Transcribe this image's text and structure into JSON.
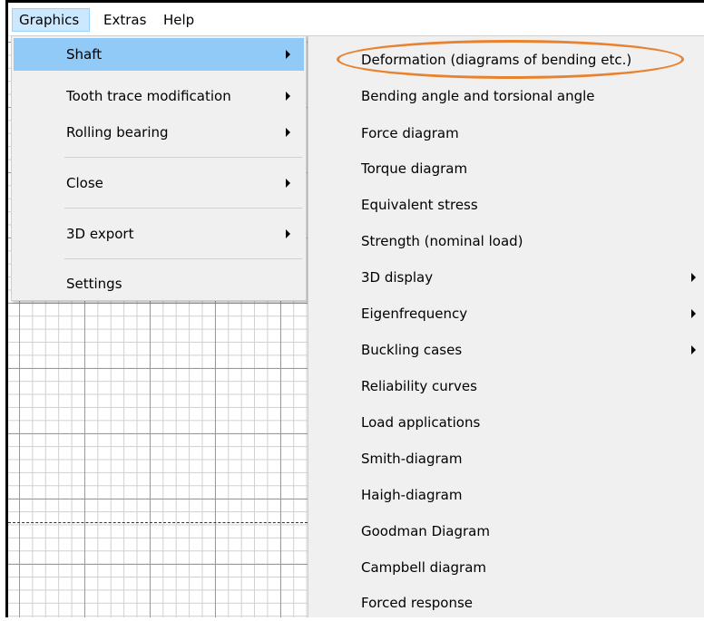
{
  "menubar": {
    "items": [
      "Graphics",
      "Extras",
      "Help"
    ]
  },
  "graphics_menu": {
    "items": [
      {
        "label": "Shaft",
        "has_submenu": true
      },
      {
        "label": "Tooth trace modification",
        "has_submenu": true
      },
      {
        "label": "Rolling bearing",
        "has_submenu": true
      },
      {
        "label": "Close",
        "has_submenu": true
      },
      {
        "label": "3D export",
        "has_submenu": true
      },
      {
        "label": "Settings",
        "has_submenu": false
      }
    ]
  },
  "shaft_submenu": {
    "items": [
      {
        "label": "Deformation (diagrams of bending etc.)",
        "has_submenu": false
      },
      {
        "label": "Bending angle and torsional angle",
        "has_submenu": false
      },
      {
        "label": "Force diagram",
        "has_submenu": false
      },
      {
        "label": "Torque diagram",
        "has_submenu": false
      },
      {
        "label": "Equivalent stress",
        "has_submenu": false
      },
      {
        "label": "Strength (nominal load)",
        "has_submenu": false
      },
      {
        "label": "3D display",
        "has_submenu": true
      },
      {
        "label": "Eigenfrequency",
        "has_submenu": true
      },
      {
        "label": "Buckling cases",
        "has_submenu": true
      },
      {
        "label": "Reliability curves",
        "has_submenu": false
      },
      {
        "label": "Load applications",
        "has_submenu": false
      },
      {
        "label": "Smith-diagram",
        "has_submenu": false
      },
      {
        "label": "Haigh-diagram",
        "has_submenu": false
      },
      {
        "label": "Goodman Diagram",
        "has_submenu": false
      },
      {
        "label": "Campbell diagram",
        "has_submenu": false
      },
      {
        "label": "Forced response",
        "has_submenu": false
      }
    ]
  },
  "colors": {
    "highlight": "#91c9f7",
    "annotation": "#e8822f",
    "menu_bg": "#f0f0f0"
  }
}
